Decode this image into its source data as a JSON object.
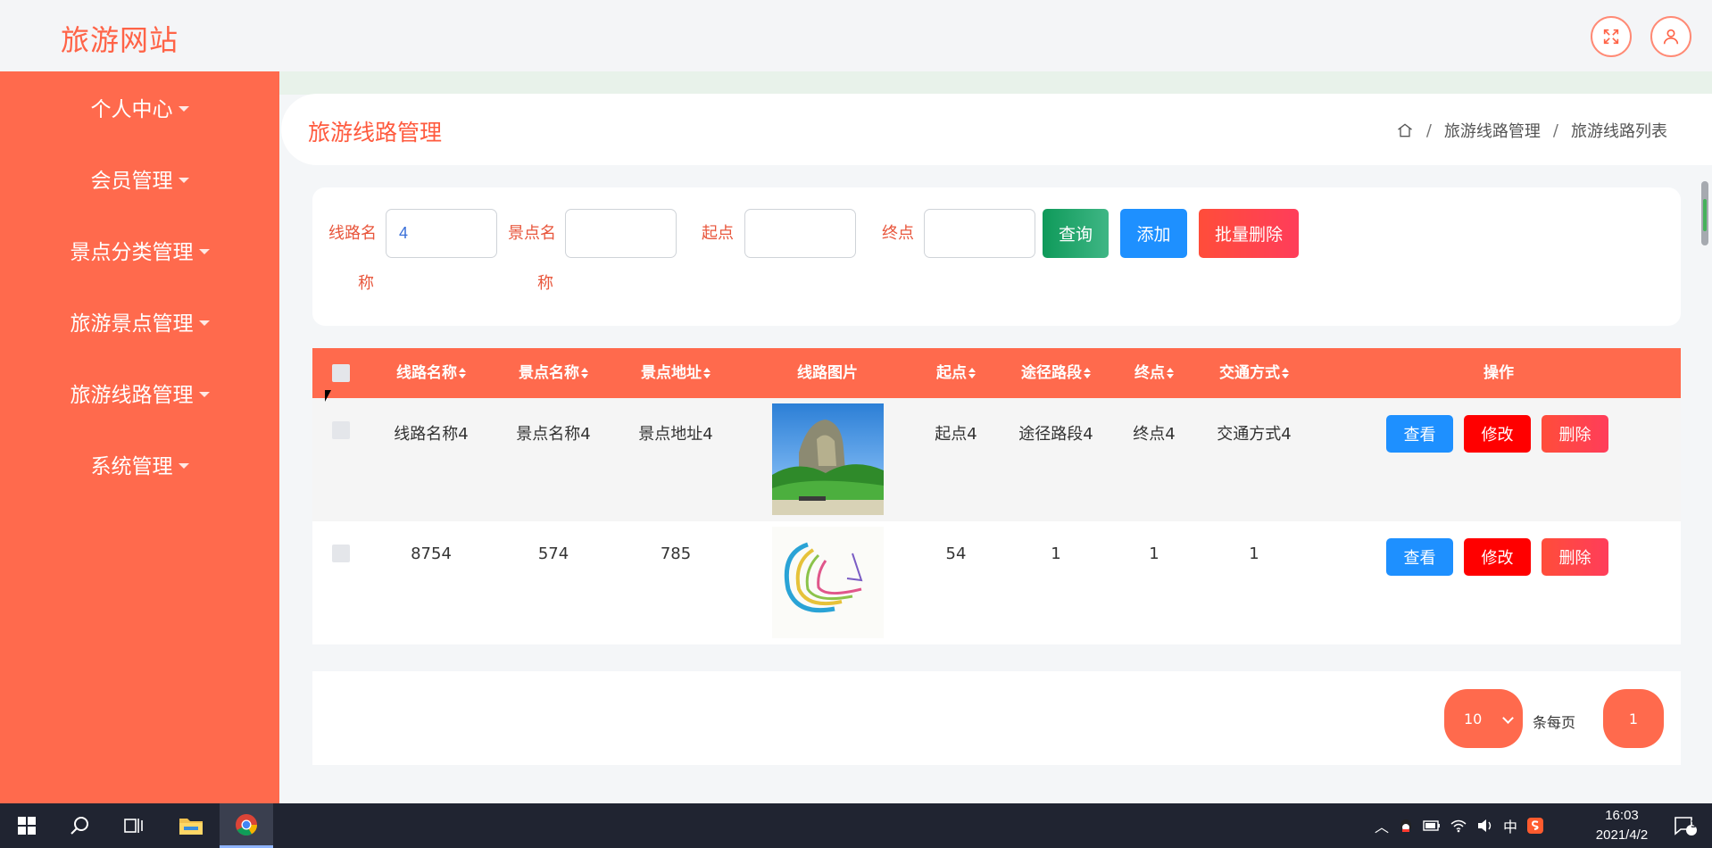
{
  "app": {
    "title": "旅游网站"
  },
  "header": {
    "fullscreen_icon": "expand-icon",
    "user_icon": "user-icon"
  },
  "sidebar": {
    "items": [
      {
        "label": "个人中心"
      },
      {
        "label": "会员管理"
      },
      {
        "label": "景点分类管理"
      },
      {
        "label": "旅游景点管理"
      },
      {
        "label": "旅游线路管理"
      },
      {
        "label": "系统管理"
      }
    ]
  },
  "page": {
    "title": "旅游线路管理",
    "breadcrumb": {
      "item1": "旅游线路管理",
      "item2": "旅游线路列表",
      "sep": "/"
    }
  },
  "search": {
    "route_label_1": "线路名",
    "route_label_2": "称",
    "route_value": "4",
    "spot_label_1": "景点名",
    "spot_label_2": "称",
    "spot_value": "",
    "start_label": "起点",
    "start_value": "",
    "end_label": "终点",
    "end_value": "",
    "query_label": "查询",
    "add_label": "添加",
    "batch_delete_label": "批量删除"
  },
  "table": {
    "columns": {
      "route_name": "线路名称",
      "spot_name": "景点名称",
      "spot_address": "景点地址",
      "route_image": "线路图片",
      "start": "起点",
      "via": "途径路段",
      "end": "终点",
      "transport": "交通方式",
      "actions": "操作"
    },
    "rows": [
      {
        "route_name": "线路名称4",
        "spot_name": "景点名称4",
        "spot_address": "景点地址4",
        "start": "起点4",
        "via": "途径路段4",
        "end": "终点4",
        "transport": "交通方式4"
      },
      {
        "route_name": "8754",
        "spot_name": "574",
        "spot_address": "785",
        "start": "54",
        "via": "1",
        "end": "1",
        "transport": "1"
      }
    ],
    "view_label": "查看",
    "edit_label": "修改",
    "delete_label": "删除"
  },
  "pager": {
    "page_size": "10",
    "per_page_label": "条每页",
    "current_page": "1"
  },
  "taskbar": {
    "time": "16:03",
    "date": "2021/4/2",
    "ime": "中",
    "notifications": "3"
  },
  "colors": {
    "primary": "#ff6a4d",
    "query": "#1aa06a",
    "add": "#1e90ff",
    "danger": "#ff4747",
    "edit": "#ff0000"
  }
}
